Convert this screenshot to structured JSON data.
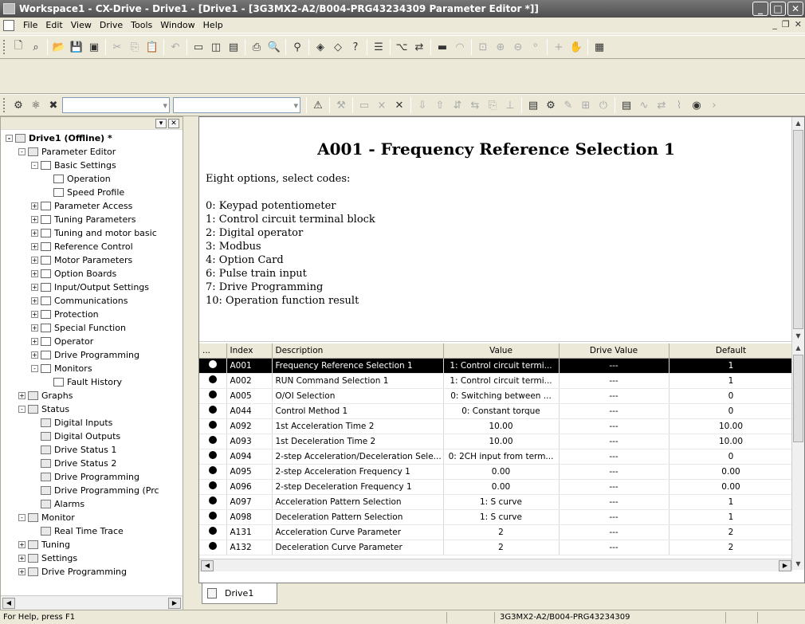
{
  "window": {
    "title": "Workspace1 - CX-Drive - Drive1 - [Drive1 - [3G3MX2-A2/B004-PRG43234309 Parameter Editor *]]"
  },
  "menu": [
    "File",
    "Edit",
    "View",
    "Drive",
    "Tools",
    "Window",
    "Help"
  ],
  "tree": [
    {
      "label": "Drive1 (Offline) *",
      "level": 0,
      "exp": "-",
      "icon": "drive-icon"
    },
    {
      "label": "Parameter Editor",
      "level": 1,
      "exp": "-",
      "icon": "editor-icon"
    },
    {
      "label": "Basic Settings",
      "level": 2,
      "exp": "-",
      "icon": "folder-icon"
    },
    {
      "label": "Operation",
      "level": 3,
      "exp": "",
      "icon": "folder-icon"
    },
    {
      "label": "Speed Profile",
      "level": 3,
      "exp": "",
      "icon": "folder-icon"
    },
    {
      "label": "Parameter Access",
      "level": 2,
      "exp": "+",
      "icon": "folder-icon"
    },
    {
      "label": "Tuning Parameters",
      "level": 2,
      "exp": "+",
      "icon": "folder-icon"
    },
    {
      "label": "Tuning and motor basic",
      "level": 2,
      "exp": "+",
      "icon": "folder-icon"
    },
    {
      "label": "Reference Control",
      "level": 2,
      "exp": "+",
      "icon": "folder-icon"
    },
    {
      "label": "Motor Parameters",
      "level": 2,
      "exp": "+",
      "icon": "folder-icon"
    },
    {
      "label": "Option Boards",
      "level": 2,
      "exp": "+",
      "icon": "folder-icon"
    },
    {
      "label": "Input/Output Settings",
      "level": 2,
      "exp": "+",
      "icon": "folder-icon"
    },
    {
      "label": "Communications",
      "level": 2,
      "exp": "+",
      "icon": "folder-icon"
    },
    {
      "label": "Protection",
      "level": 2,
      "exp": "+",
      "icon": "folder-icon"
    },
    {
      "label": "Special Function",
      "level": 2,
      "exp": "+",
      "icon": "folder-icon"
    },
    {
      "label": "Operator",
      "level": 2,
      "exp": "+",
      "icon": "folder-icon"
    },
    {
      "label": "Drive Programming",
      "level": 2,
      "exp": "+",
      "icon": "folder-icon"
    },
    {
      "label": "Monitors",
      "level": 2,
      "exp": "-",
      "icon": "folder-icon"
    },
    {
      "label": "Fault History",
      "level": 3,
      "exp": "",
      "icon": "folder-icon"
    },
    {
      "label": "Graphs",
      "level": 1,
      "exp": "+",
      "icon": "graph-icon"
    },
    {
      "label": "Status",
      "level": 1,
      "exp": "-",
      "icon": "status-icon"
    },
    {
      "label": "Digital Inputs",
      "level": 2,
      "exp": "",
      "icon": "status-item-icon"
    },
    {
      "label": "Digital Outputs",
      "level": 2,
      "exp": "",
      "icon": "status-item-icon"
    },
    {
      "label": "Drive Status 1",
      "level": 2,
      "exp": "",
      "icon": "status-item-icon"
    },
    {
      "label": "Drive Status 2",
      "level": 2,
      "exp": "",
      "icon": "status-item-icon"
    },
    {
      "label": "Drive Programming",
      "level": 2,
      "exp": "",
      "icon": "status-item-icon"
    },
    {
      "label": "Drive Programming (Prc",
      "level": 2,
      "exp": "",
      "icon": "status-item-icon"
    },
    {
      "label": "Alarms",
      "level": 2,
      "exp": "",
      "icon": "alarm-icon"
    },
    {
      "label": "Monitor",
      "level": 1,
      "exp": "-",
      "icon": "monitor-icon"
    },
    {
      "label": "Real Time Trace",
      "level": 2,
      "exp": "",
      "icon": "trace-icon"
    },
    {
      "label": "Tuning",
      "level": 1,
      "exp": "+",
      "icon": "tuning-icon"
    },
    {
      "label": "Settings",
      "level": 1,
      "exp": "+",
      "icon": "settings-icon"
    },
    {
      "label": "Drive Programming",
      "level": 1,
      "exp": "+",
      "icon": "program-icon"
    }
  ],
  "help": {
    "title": "A001 - Frequency Reference Selection 1",
    "subtitle": "Eight options, select codes:",
    "lines": [
      "0: Keypad potentiometer",
      "1: Control circuit terminal block",
      "2: Digital operator",
      "3: Modbus",
      "4: Option Card",
      "6: Pulse train input",
      "7: Drive Programming",
      "10: Operation function result"
    ]
  },
  "table": {
    "headers": [
      "...",
      "Index",
      "Description",
      "Value",
      "Drive Value",
      "Default"
    ],
    "rows": [
      [
        "A001",
        "Frequency Reference Selection 1",
        "1: Control circuit termi...",
        "---",
        "1"
      ],
      [
        "A002",
        "RUN Command Selection 1",
        "1: Control circuit termi...",
        "---",
        "1"
      ],
      [
        "A005",
        "O/OI Selection",
        "0: Switching between ...",
        "---",
        "0"
      ],
      [
        "A044",
        "Control Method 1",
        "0: Constant torque",
        "---",
        "0"
      ],
      [
        "A092",
        "1st Acceleration Time 2",
        "10.00",
        "---",
        "10.00"
      ],
      [
        "A093",
        "1st Deceleration Time 2",
        "10.00",
        "---",
        "10.00"
      ],
      [
        "A094",
        "2-step Acceleration/Deceleration Sele...",
        "0: 2CH input from term...",
        "---",
        "0"
      ],
      [
        "A095",
        "2-step Acceleration Frequency 1",
        "0.00",
        "---",
        "0.00"
      ],
      [
        "A096",
        "2-step Deceleration Frequency 1",
        "0.00",
        "---",
        "0.00"
      ],
      [
        "A097",
        "Acceleration Pattern Selection",
        "1: S curve",
        "---",
        "1"
      ],
      [
        "A098",
        "Deceleration Pattern Selection",
        "1: S curve",
        "---",
        "1"
      ],
      [
        "A131",
        "Acceleration Curve Parameter",
        "2",
        "---",
        "2"
      ],
      [
        "A132",
        "Deceleration Curve Parameter",
        "2",
        "---",
        "2"
      ]
    ],
    "selected_row": 0
  },
  "tab": {
    "label": "Drive1"
  },
  "status": {
    "left": "For Help, press F1",
    "center": "3G3MX2-A2/B004-PRG43234309"
  }
}
